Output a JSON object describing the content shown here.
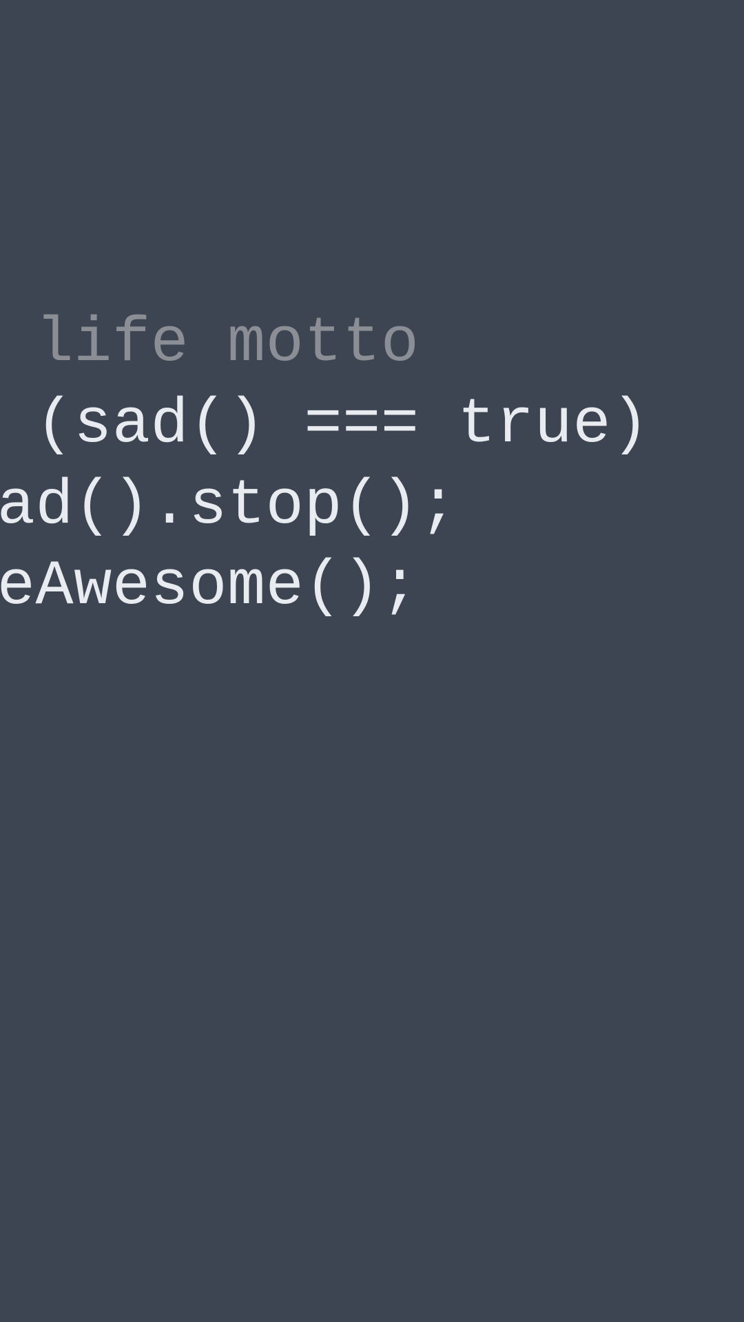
{
  "colors": {
    "background": "#3e4552",
    "comment": "#8b8f95",
    "code": "#e8ebef"
  },
  "lines": {
    "line1": "/ life motto",
    "line2": "f (sad() === true)",
    "line3": "sad().stop();",
    "line4": "beAwesome();"
  }
}
